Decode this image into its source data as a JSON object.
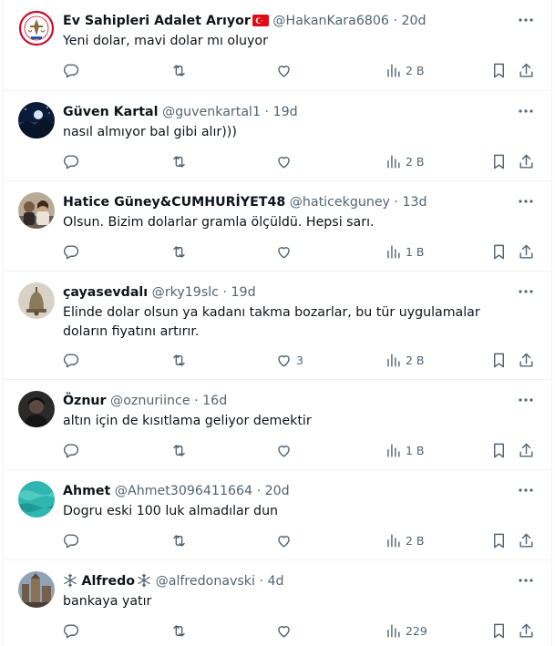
{
  "tweets": [
    {
      "name": "Ev Sahipleri Adalet Arıyor",
      "handle": "@HakanKara6806",
      "separator": "·",
      "time": "20d",
      "text": "Yeni dolar, mavi dolar mı oluyor",
      "likes": "",
      "views": "2 B",
      "avatar_icon": "organization-seal-avatar",
      "flag_icon": "turkey-flag-icon"
    },
    {
      "name": "Güven Kartal",
      "handle": "@guvenkartal1",
      "separator": "·",
      "time": "19d",
      "text": "nasıl almıyor bal gibi alır)))",
      "likes": "",
      "views": "2 B",
      "avatar_icon": "night-landscape-avatar"
    },
    {
      "name": "Hatice Güney&CUMHURİYET48",
      "handle": "@haticekguney",
      "separator": "·",
      "time": "13d",
      "text": "Olsun. Bizim dolarlar gramla ölçüldü. Hepsi sarı.",
      "likes": "",
      "views": "1 B",
      "avatar_icon": "group-photo-avatar"
    },
    {
      "name": "çayasevdalı",
      "handle": "@rky19slc",
      "separator": "·",
      "time": "19d",
      "text": "Elinde dolar olsun ya kadanı takma bozarlar, bu tür uygulamalar doların fiyatını artırır.",
      "likes": "3",
      "views": "2 B",
      "avatar_icon": "bell-photo-avatar"
    },
    {
      "name": "Öznur",
      "handle": "@oznuriince",
      "separator": "·",
      "time": "16d",
      "text": "altın için de kısıtlama geliyor demektir",
      "likes": "",
      "views": "1 B",
      "avatar_icon": "dark-portrait-avatar"
    },
    {
      "name": "Ahmet",
      "handle": "@Ahmet3096411664",
      "separator": "·",
      "time": "20d",
      "text": "Dogru eski 100 luk almadılar dun",
      "likes": "",
      "views": "2 B",
      "avatar_icon": "turquoise-water-avatar"
    },
    {
      "name": "Alfredo",
      "handle": "@alfredonavski",
      "separator": "·",
      "time": "4d",
      "text": "bankaya yatır",
      "likes": "",
      "views": "229",
      "avatar_icon": "city-photo-avatar",
      "name_prefix_icon": "snowflake-icon",
      "name_suffix_icon": "snowflake-icon"
    }
  ],
  "colors": {
    "text_primary": "#0f1419",
    "text_secondary": "#536471",
    "divider": "#eff3f4",
    "flag_red": "#e30a17"
  },
  "action_icons": [
    "reply-icon",
    "retweet-icon",
    "like-icon",
    "views-icon",
    "bookmark-icon",
    "share-icon"
  ]
}
